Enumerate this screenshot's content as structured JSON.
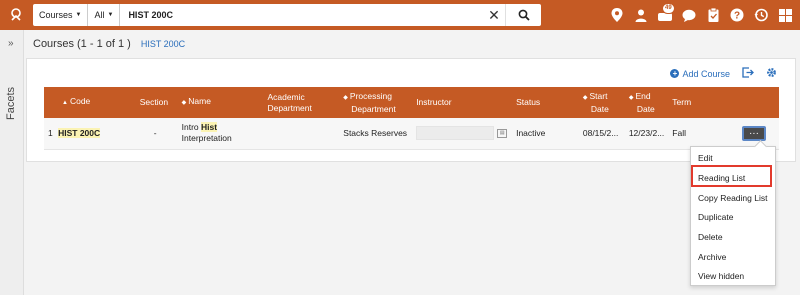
{
  "search": {
    "scope": "Courses",
    "field": "All",
    "query": "HIST 200C"
  },
  "topbar": {
    "notification_count": "49",
    "icons": [
      "location-pin-icon",
      "user-icon",
      "tasks-icon",
      "chat-icon",
      "clipboard-icon",
      "help-icon",
      "history-icon",
      "apps-grid-icon"
    ]
  },
  "facets": {
    "label": "Facets"
  },
  "page": {
    "title": "Courses (1 - 1 of 1 )",
    "search_chip": "HIST 200C"
  },
  "toolbar": {
    "add_course": "Add Course"
  },
  "table": {
    "columns": {
      "code": "Code",
      "section": "Section",
      "name": "Name",
      "academic_department_1": "Academic",
      "academic_department_2": "Department",
      "processing_department_1": "Processing",
      "processing_department_2": "Department",
      "instructor": "Instructor",
      "status": "Status",
      "start_date_1": "Start",
      "start_date_2": "Date",
      "end_date_1": "End",
      "end_date_2": "Date",
      "term": "Term"
    },
    "rows": [
      {
        "index": "1",
        "code": "HIST 200C",
        "section": "-",
        "name_part1": "Intro ",
        "name_highlight": "Hist",
        "name_part2": "Interpretation",
        "processing_department": "Stacks Reserves",
        "status": "Inactive",
        "start_date": "08/15/2...",
        "end_date": "12/23/2...",
        "term": "Fall",
        "actions_label": "···"
      }
    ]
  },
  "row_menu": {
    "items": [
      "Edit",
      "Reading List",
      "Copy Reading List",
      "Duplicate",
      "Delete",
      "Archive",
      "View hidden"
    ]
  },
  "colors": {
    "brand": "#c55a24",
    "link": "#2a6ebb",
    "highlight": "#fbf3b3",
    "focus_outline": "#e23a2c"
  }
}
